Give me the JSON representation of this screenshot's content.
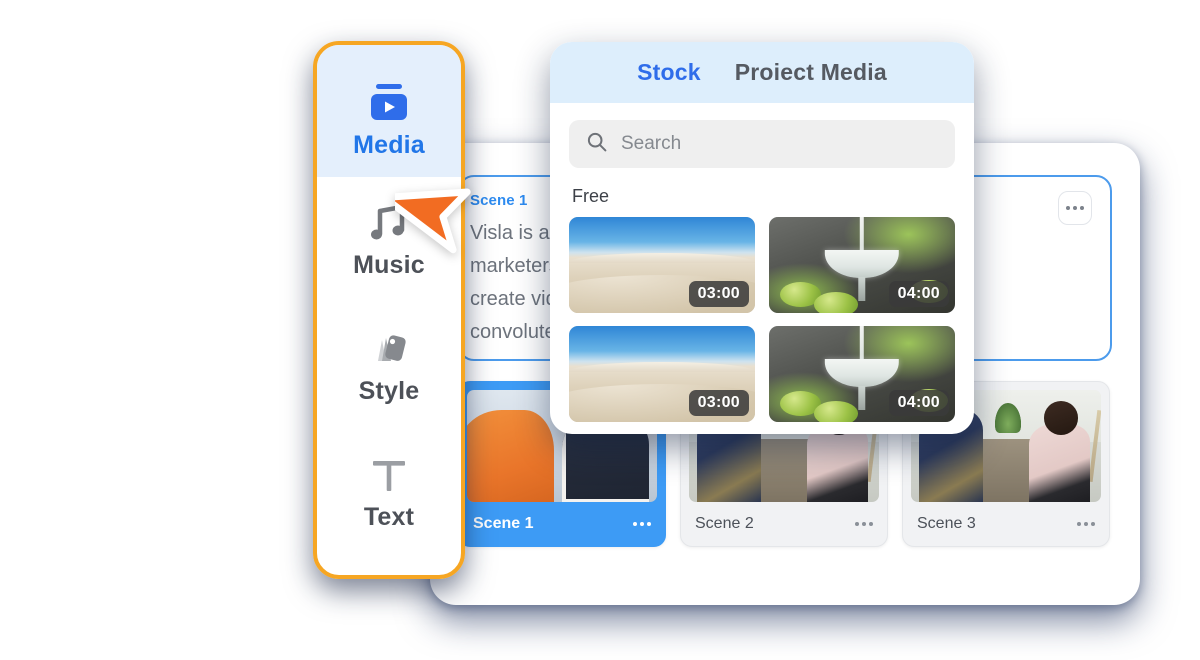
{
  "app": {
    "script_panel": {
      "scene_label": "Scene 1",
      "body": "Visla is a platform for digital\nmarketers and creators to help them\ncreate videos without learning the\nconvoluted tools.",
      "more_label": "…"
    },
    "scenes": [
      {
        "name": "Scene 1",
        "thumb": "office-handshake",
        "selected": true
      },
      {
        "name": "Scene 2",
        "thumb": "couch-conversation",
        "selected": false
      },
      {
        "name": "Scene 3",
        "thumb": "couch-conversation",
        "selected": false
      }
    ]
  },
  "sidebar": {
    "items": [
      {
        "label": "Media",
        "icon": "media-icon",
        "active": true
      },
      {
        "label": "Music",
        "icon": "music-note-icon",
        "active": false
      },
      {
        "label": "Style",
        "icon": "style-cards-icon",
        "active": false
      },
      {
        "label": "Text",
        "icon": "text-t-icon",
        "active": false
      }
    ]
  },
  "popup": {
    "tabs": [
      {
        "label": "Stock",
        "active": true
      },
      {
        "label": "Proiect Media",
        "active": false
      }
    ],
    "search": {
      "placeholder": "Search",
      "value": "",
      "icon": "search-icon"
    },
    "section_label": "Free",
    "media": [
      {
        "thumb": "desert-dunes",
        "duration": "03:00"
      },
      {
        "thumb": "cocktail-pour",
        "duration": "04:00"
      },
      {
        "thumb": "desert-dunes",
        "duration": "03:00"
      },
      {
        "thumb": "cocktail-pour",
        "duration": "04:00"
      }
    ]
  },
  "colors": {
    "accent_blue": "#2f6dea",
    "highlight_orange": "#f6a623",
    "selected_card_blue": "#3d9bf5",
    "panel_border_blue": "#4c9bec",
    "tab_bar_blue": "#ddeefc",
    "cursor_orange": "#f26c22",
    "window_shadow_navy": "#172a57"
  },
  "cursor": {
    "icon": "arrow-pointer-icon"
  }
}
